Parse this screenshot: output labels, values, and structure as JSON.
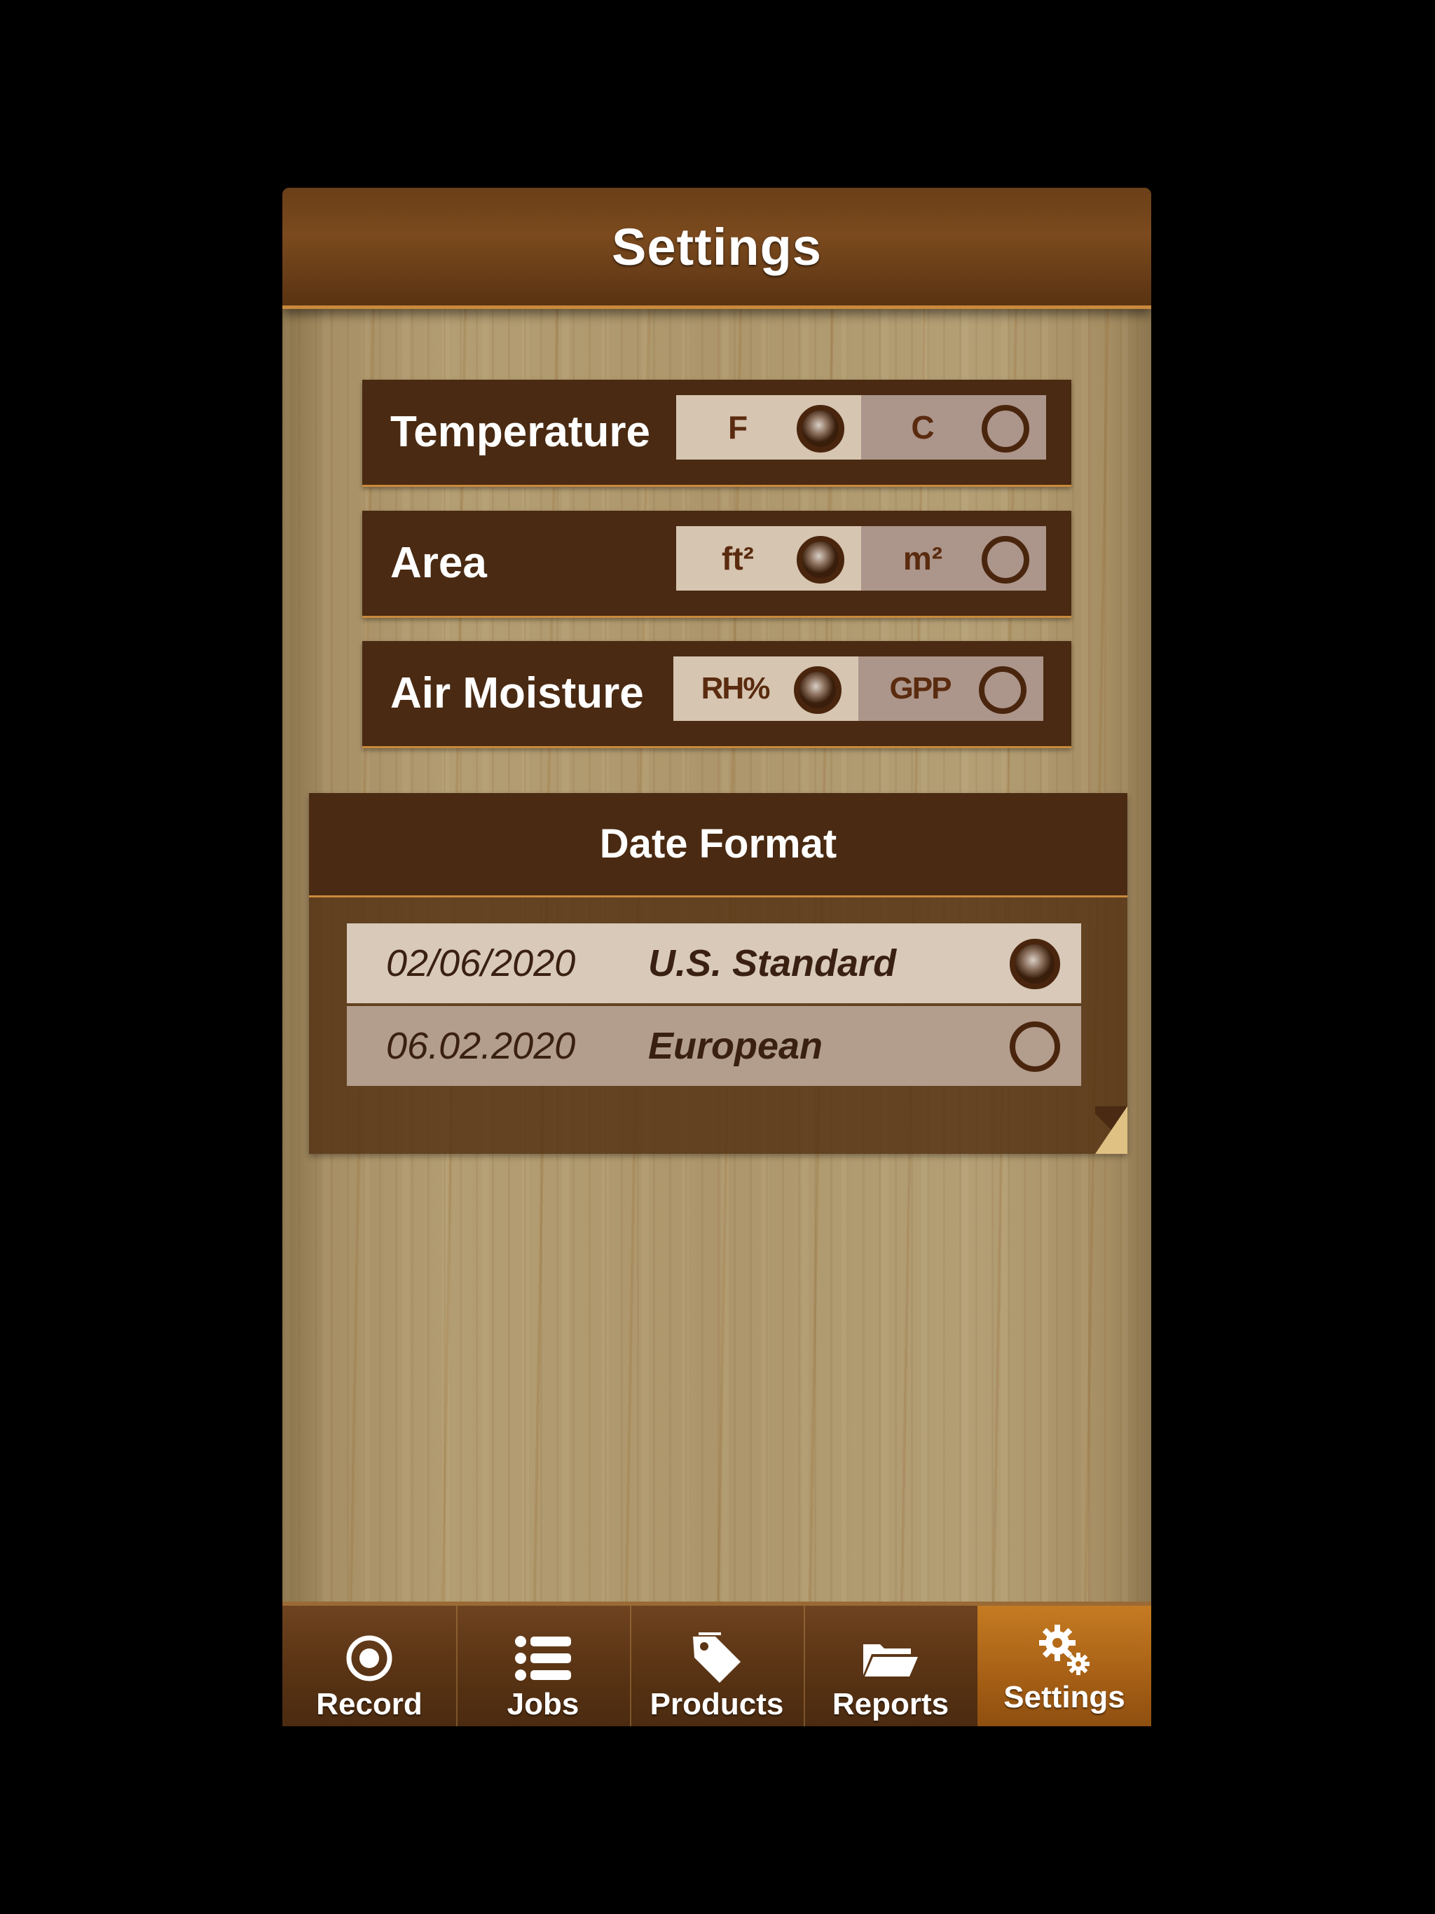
{
  "nav": {
    "title": "Settings"
  },
  "settings": [
    {
      "label": "Temperature",
      "options": [
        {
          "label": "F",
          "selected": true
        },
        {
          "label": "C",
          "selected": false
        }
      ]
    },
    {
      "label": "Area",
      "options": [
        {
          "label": "ft²",
          "selected": true
        },
        {
          "label": "m²",
          "selected": false
        }
      ]
    },
    {
      "label": "Air Moisture",
      "options": [
        {
          "label": "RH%",
          "selected": true
        },
        {
          "label": "GPP",
          "selected": false
        }
      ]
    }
  ],
  "date_format": {
    "title": "Date Format",
    "options": [
      {
        "value": "02/06/2020",
        "name": "U.S.  Standard",
        "selected": true
      },
      {
        "value": "06.02.2020",
        "name": "European",
        "selected": false
      }
    ]
  },
  "tabs": [
    {
      "label": "Record",
      "icon": "record-icon",
      "active": false
    },
    {
      "label": "Jobs",
      "icon": "list-icon",
      "active": false
    },
    {
      "label": "Products",
      "icon": "tag-icon",
      "active": false
    },
    {
      "label": "Reports",
      "icon": "folder-icon",
      "active": false
    },
    {
      "label": "Settings",
      "icon": "gears-icon",
      "active": true
    }
  ],
  "colors": {
    "header": "#4a2a12",
    "accent": "#c98a3c",
    "active_tab": "#b56a18"
  }
}
